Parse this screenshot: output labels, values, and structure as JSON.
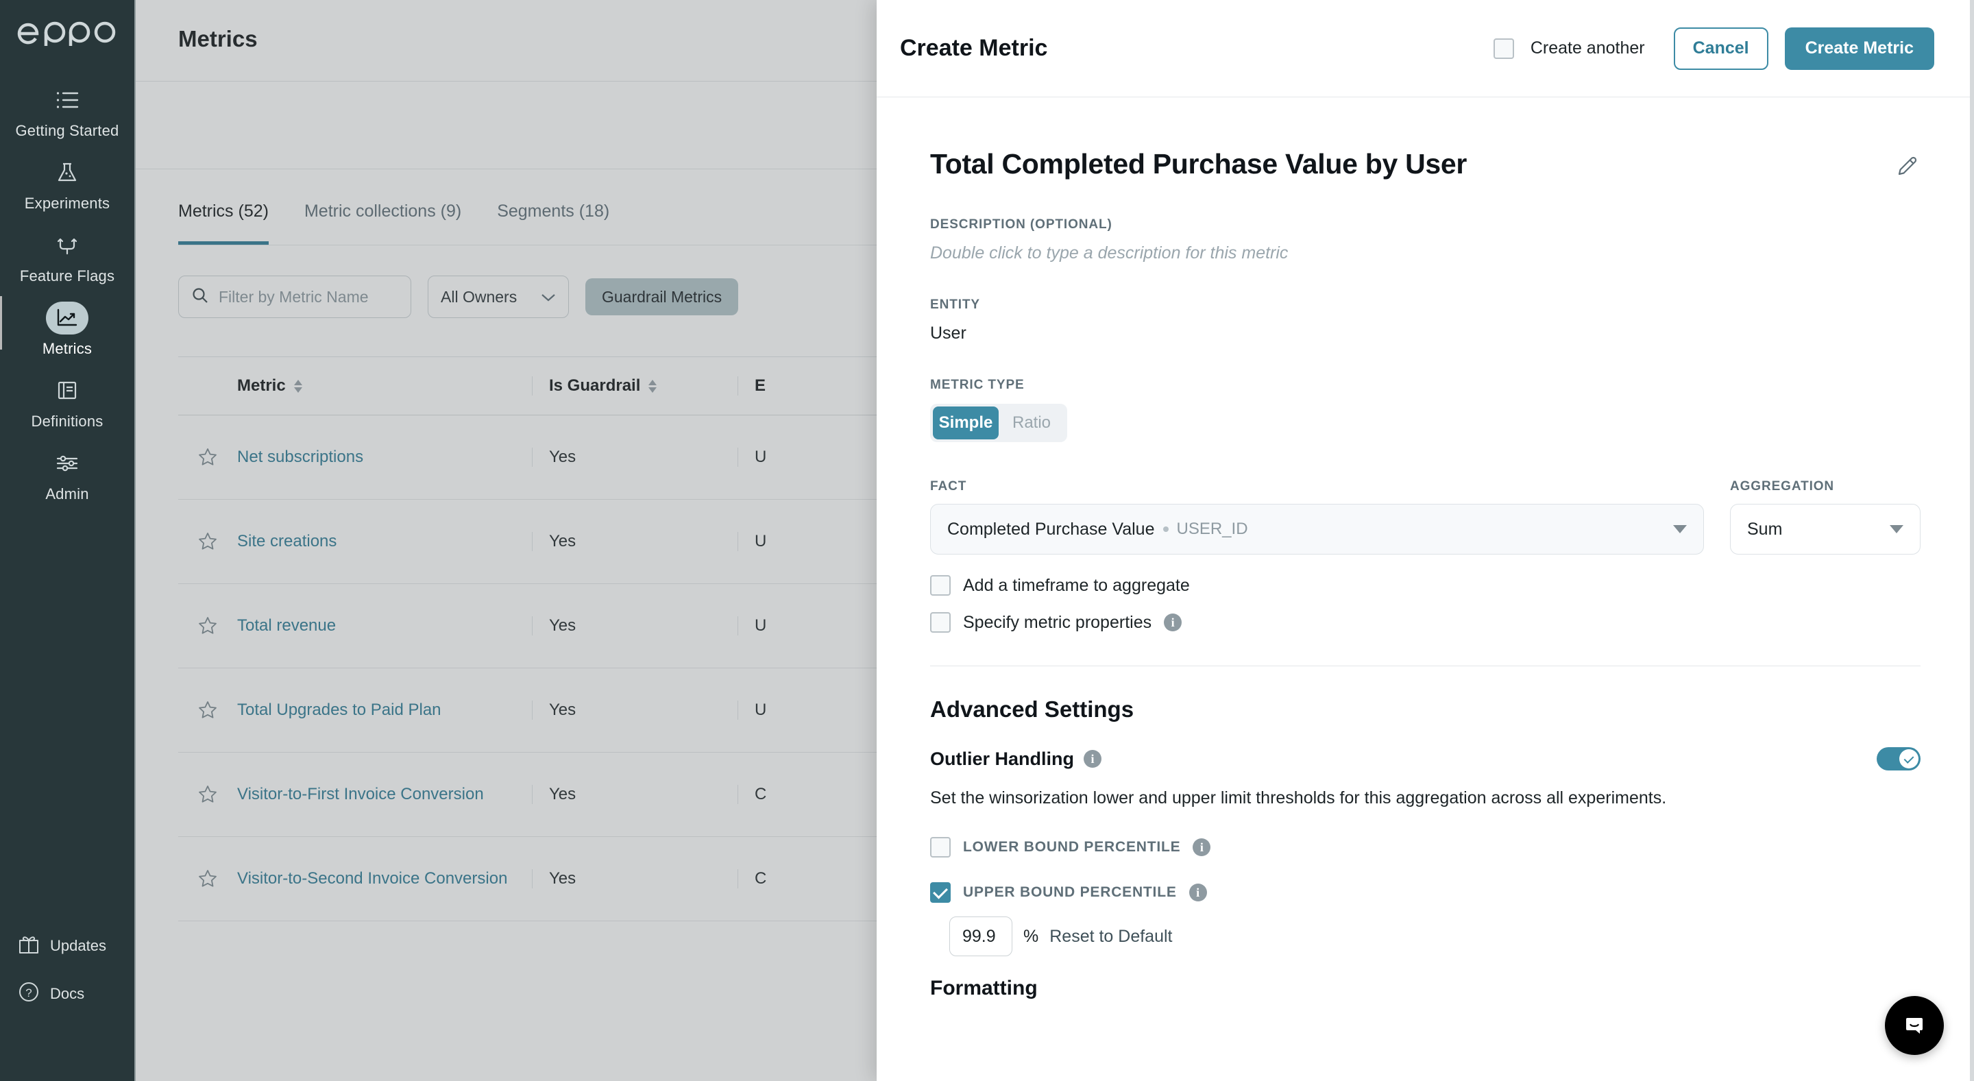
{
  "sidebar": {
    "logo": "eppo",
    "items": [
      {
        "label": "Getting Started",
        "icon": "list-icon",
        "active": false
      },
      {
        "label": "Experiments",
        "icon": "flask-icon",
        "active": false
      },
      {
        "label": "Feature Flags",
        "icon": "branch-icon",
        "active": false
      },
      {
        "label": "Metrics",
        "icon": "chart-line-icon",
        "active": true
      },
      {
        "label": "Definitions",
        "icon": "book-icon",
        "active": false
      },
      {
        "label": "Admin",
        "icon": "sliders-icon",
        "active": false
      }
    ],
    "bottom": [
      {
        "label": "Updates",
        "icon": "gift-icon"
      },
      {
        "label": "Docs",
        "icon": "question-circle-icon"
      }
    ]
  },
  "page": {
    "title": "Metrics",
    "tabs": [
      {
        "label": "Metrics (52)",
        "active": true
      },
      {
        "label": "Metric collections (9)",
        "active": false
      },
      {
        "label": "Segments (18)",
        "active": false
      }
    ],
    "filters": {
      "search_placeholder": "Filter by Metric Name",
      "owner_value": "All Owners",
      "chip_label": "Guardrail Metrics"
    },
    "table": {
      "columns": [
        "Metric",
        "Is Guardrail",
        "E"
      ],
      "rows": [
        {
          "metric": "Net subscriptions",
          "guardrail": "Yes",
          "entity": "U"
        },
        {
          "metric": "Site creations",
          "guardrail": "Yes",
          "entity": "U"
        },
        {
          "metric": "Total revenue",
          "guardrail": "Yes",
          "entity": "U"
        },
        {
          "metric": "Total Upgrades to Paid Plan",
          "guardrail": "Yes",
          "entity": "U"
        },
        {
          "metric": "Visitor-to-First Invoice Conversion",
          "guardrail": "Yes",
          "entity": "C"
        },
        {
          "metric": "Visitor-to-Second Invoice Conversion",
          "guardrail": "Yes",
          "entity": "C"
        }
      ]
    }
  },
  "modal": {
    "header": {
      "title": "Create Metric",
      "create_another_label": "Create another",
      "create_another_checked": false,
      "cancel_label": "Cancel",
      "submit_label": "Create Metric"
    },
    "metric_name": "Total Completed Purchase Value by User",
    "edit_icon": "pencil-icon",
    "description": {
      "label": "DESCRIPTION (OPTIONAL)",
      "placeholder": "Double click to type a description for this metric"
    },
    "entity": {
      "label": "ENTITY",
      "value": "User"
    },
    "metric_type": {
      "label": "METRIC TYPE",
      "options": [
        "Simple",
        "Ratio"
      ],
      "selected": "Simple"
    },
    "fact": {
      "label": "FACT",
      "value": "Completed Purchase Value",
      "qualifier": "USER_ID"
    },
    "aggregation": {
      "label": "AGGREGATION",
      "value": "Sum"
    },
    "checkboxes": [
      {
        "label": "Add a timeframe to aggregate",
        "checked": false,
        "info": false
      },
      {
        "label": "Specify metric properties",
        "checked": false,
        "info": true
      }
    ],
    "advanced": {
      "title": "Advanced Settings",
      "outlier": {
        "title": "Outlier Handling",
        "toggle_on": true,
        "description": "Set the winsorization lower and upper limit thresholds for this aggregation across all experiments."
      },
      "lower_bound": {
        "label": "LOWER BOUND PERCENTILE",
        "checked": false
      },
      "upper_bound": {
        "label": "UPPER BOUND PERCENTILE",
        "checked": true
      },
      "percentile_value": "99.9",
      "percent_sign": "%",
      "reset_label": "Reset to Default",
      "formatting_title": "Formatting"
    }
  },
  "colors": {
    "sidebar_bg": "#28373a",
    "accent_teal": "#3d8ba5",
    "link_teal": "#2f7d97",
    "chip_bg": "#b4c5ca"
  }
}
